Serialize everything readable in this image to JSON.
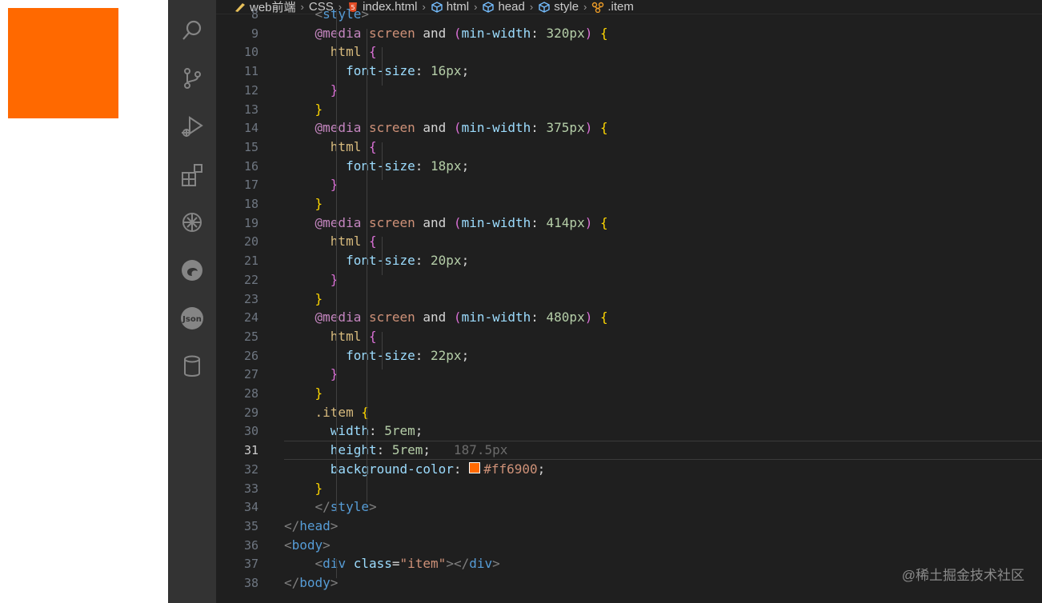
{
  "preview": {
    "box_color": "#ff6900"
  },
  "activity_bar": [
    {
      "name": "search-icon"
    },
    {
      "name": "source-control-icon"
    },
    {
      "name": "run-debug-icon"
    },
    {
      "name": "extensions-icon"
    },
    {
      "name": "chatgpt-icon"
    },
    {
      "name": "edge-icon"
    },
    {
      "name": "json-icon"
    },
    {
      "name": "database-icon"
    }
  ],
  "breadcrumb": {
    "items": [
      "web前端",
      "CSS",
      "index.html",
      "html",
      "head",
      "style",
      ".item"
    ]
  },
  "editor": {
    "current_line": 31,
    "inlay_hint": "187.5px",
    "lines": [
      {
        "n": "8",
        "tokens": [
          [
            "    ",
            "t-plain"
          ],
          [
            "<",
            "t-punct"
          ],
          [
            "style",
            "t-tag"
          ],
          [
            ">",
            "t-punct"
          ]
        ]
      },
      {
        "n": "9",
        "tokens": [
          [
            "    ",
            "t-plain"
          ],
          [
            "@media",
            "t-at"
          ],
          [
            " screen ",
            "t-kw"
          ],
          [
            "and ",
            "t-and"
          ],
          [
            "(",
            "t-brace2"
          ],
          [
            "min-width",
            "t-prop"
          ],
          [
            ": ",
            "t-plain"
          ],
          [
            "320px",
            "t-num"
          ],
          [
            ") ",
            "t-brace2"
          ],
          [
            "{",
            "t-brace1"
          ]
        ]
      },
      {
        "n": "10",
        "tokens": [
          [
            "      ",
            "t-plain"
          ],
          [
            "html ",
            "t-sel"
          ],
          [
            "{",
            "t-brace2"
          ]
        ]
      },
      {
        "n": "11",
        "tokens": [
          [
            "        ",
            "t-plain"
          ],
          [
            "font-size",
            "t-prop"
          ],
          [
            ": ",
            "t-plain"
          ],
          [
            "16px",
            "t-num"
          ],
          [
            ";",
            "t-plain"
          ]
        ]
      },
      {
        "n": "12",
        "tokens": [
          [
            "      ",
            "t-plain"
          ],
          [
            "}",
            "t-brace2"
          ]
        ]
      },
      {
        "n": "13",
        "tokens": [
          [
            "    ",
            "t-plain"
          ],
          [
            "}",
            "t-brace1"
          ]
        ]
      },
      {
        "n": "14",
        "tokens": [
          [
            "    ",
            "t-plain"
          ],
          [
            "@media",
            "t-at"
          ],
          [
            " screen ",
            "t-kw"
          ],
          [
            "and ",
            "t-and"
          ],
          [
            "(",
            "t-brace2"
          ],
          [
            "min-width",
            "t-prop"
          ],
          [
            ": ",
            "t-plain"
          ],
          [
            "375px",
            "t-num"
          ],
          [
            ") ",
            "t-brace2"
          ],
          [
            "{",
            "t-brace1"
          ]
        ]
      },
      {
        "n": "15",
        "tokens": [
          [
            "      ",
            "t-plain"
          ],
          [
            "html ",
            "t-sel"
          ],
          [
            "{",
            "t-brace2"
          ]
        ]
      },
      {
        "n": "16",
        "tokens": [
          [
            "        ",
            "t-plain"
          ],
          [
            "font-size",
            "t-prop"
          ],
          [
            ": ",
            "t-plain"
          ],
          [
            "18px",
            "t-num"
          ],
          [
            ";",
            "t-plain"
          ]
        ]
      },
      {
        "n": "17",
        "tokens": [
          [
            "      ",
            "t-plain"
          ],
          [
            "}",
            "t-brace2"
          ]
        ]
      },
      {
        "n": "18",
        "tokens": [
          [
            "    ",
            "t-plain"
          ],
          [
            "}",
            "t-brace1"
          ]
        ]
      },
      {
        "n": "19",
        "tokens": [
          [
            "    ",
            "t-plain"
          ],
          [
            "@media",
            "t-at"
          ],
          [
            " screen ",
            "t-kw"
          ],
          [
            "and ",
            "t-and"
          ],
          [
            "(",
            "t-brace2"
          ],
          [
            "min-width",
            "t-prop"
          ],
          [
            ": ",
            "t-plain"
          ],
          [
            "414px",
            "t-num"
          ],
          [
            ") ",
            "t-brace2"
          ],
          [
            "{",
            "t-brace1"
          ]
        ]
      },
      {
        "n": "20",
        "tokens": [
          [
            "      ",
            "t-plain"
          ],
          [
            "html ",
            "t-sel"
          ],
          [
            "{",
            "t-brace2"
          ]
        ]
      },
      {
        "n": "21",
        "tokens": [
          [
            "        ",
            "t-plain"
          ],
          [
            "font-size",
            "t-prop"
          ],
          [
            ": ",
            "t-plain"
          ],
          [
            "20px",
            "t-num"
          ],
          [
            ";",
            "t-plain"
          ]
        ]
      },
      {
        "n": "22",
        "tokens": [
          [
            "      ",
            "t-plain"
          ],
          [
            "}",
            "t-brace2"
          ]
        ]
      },
      {
        "n": "23",
        "tokens": [
          [
            "    ",
            "t-plain"
          ],
          [
            "}",
            "t-brace1"
          ]
        ]
      },
      {
        "n": "24",
        "tokens": [
          [
            "    ",
            "t-plain"
          ],
          [
            "@media",
            "t-at"
          ],
          [
            " screen ",
            "t-kw"
          ],
          [
            "and ",
            "t-and"
          ],
          [
            "(",
            "t-brace2"
          ],
          [
            "min-width",
            "t-prop"
          ],
          [
            ": ",
            "t-plain"
          ],
          [
            "480px",
            "t-num"
          ],
          [
            ") ",
            "t-brace2"
          ],
          [
            "{",
            "t-brace1"
          ]
        ]
      },
      {
        "n": "25",
        "tokens": [
          [
            "      ",
            "t-plain"
          ],
          [
            "html ",
            "t-sel"
          ],
          [
            "{",
            "t-brace2"
          ]
        ]
      },
      {
        "n": "26",
        "tokens": [
          [
            "        ",
            "t-plain"
          ],
          [
            "font-size",
            "t-prop"
          ],
          [
            ": ",
            "t-plain"
          ],
          [
            "22px",
            "t-num"
          ],
          [
            ";",
            "t-plain"
          ]
        ]
      },
      {
        "n": "27",
        "tokens": [
          [
            "      ",
            "t-plain"
          ],
          [
            "}",
            "t-brace2"
          ]
        ]
      },
      {
        "n": "28",
        "tokens": [
          [
            "    ",
            "t-plain"
          ],
          [
            "}",
            "t-brace1"
          ]
        ]
      },
      {
        "n": "29",
        "tokens": [
          [
            "    ",
            "t-plain"
          ],
          [
            ".item ",
            "t-sel"
          ],
          [
            "{",
            "t-brace1"
          ]
        ]
      },
      {
        "n": "30",
        "tokens": [
          [
            "      ",
            "t-plain"
          ],
          [
            "width",
            "t-prop"
          ],
          [
            ": ",
            "t-plain"
          ],
          [
            "5rem",
            "t-num"
          ],
          [
            ";",
            "t-plain"
          ]
        ]
      },
      {
        "n": "31",
        "tokens": [
          [
            "      ",
            "t-plain"
          ],
          [
            "height",
            "t-prop"
          ],
          [
            ": ",
            "t-plain"
          ],
          [
            "5rem",
            "t-num"
          ],
          [
            ";",
            "t-plain"
          ]
        ],
        "hint": true
      },
      {
        "n": "32",
        "tokens": [
          [
            "      ",
            "t-plain"
          ],
          [
            "background-color",
            "t-prop"
          ],
          [
            ": ",
            "t-plain"
          ],
          [
            "#ff6900",
            "t-kw"
          ],
          [
            ";",
            "t-plain"
          ]
        ],
        "swatch": true
      },
      {
        "n": "33",
        "tokens": [
          [
            "    ",
            "t-plain"
          ],
          [
            "}",
            "t-brace1"
          ]
        ]
      },
      {
        "n": "34",
        "tokens": [
          [
            "    ",
            "t-plain"
          ],
          [
            "</",
            "t-punct"
          ],
          [
            "style",
            "t-tag"
          ],
          [
            ">",
            "t-punct"
          ]
        ]
      },
      {
        "n": "35",
        "tokens": [
          [
            "",
            "t-plain"
          ],
          [
            "</",
            "t-punct"
          ],
          [
            "head",
            "t-tag"
          ],
          [
            ">",
            "t-punct"
          ]
        ]
      },
      {
        "n": "36",
        "tokens": [
          [
            "",
            "t-plain"
          ],
          [
            "<",
            "t-punct"
          ],
          [
            "body",
            "t-tag"
          ],
          [
            ">",
            "t-punct"
          ]
        ]
      },
      {
        "n": "37",
        "tokens": [
          [
            "    ",
            "t-plain"
          ],
          [
            "<",
            "t-punct"
          ],
          [
            "div ",
            "t-tag"
          ],
          [
            "class",
            "t-attr"
          ],
          [
            "=",
            "t-plain"
          ],
          [
            "\"item\"",
            "t-str"
          ],
          [
            "></",
            "t-punct"
          ],
          [
            "div",
            "t-tag"
          ],
          [
            ">",
            "t-punct"
          ]
        ]
      },
      {
        "n": "38",
        "tokens": [
          [
            "",
            "t-plain"
          ],
          [
            "</",
            "t-punct"
          ],
          [
            "body",
            "t-tag"
          ],
          [
            ">",
            "t-punct"
          ]
        ]
      }
    ]
  },
  "watermark": "@稀土掘金技术社区"
}
